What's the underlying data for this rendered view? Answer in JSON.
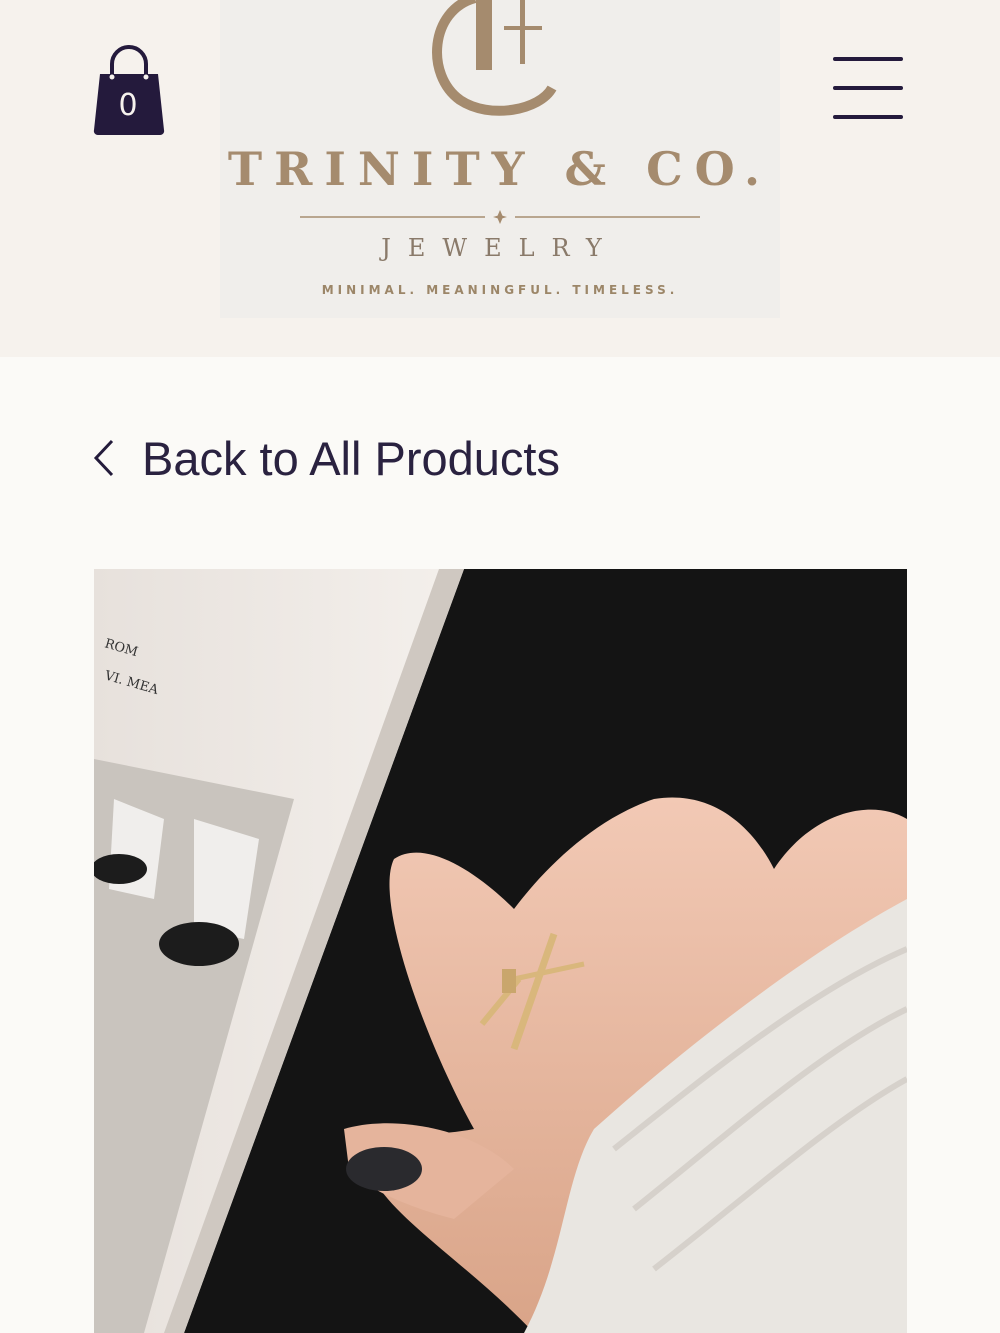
{
  "header": {
    "cart_count": "0",
    "brand": {
      "monogram": "C",
      "name": "TRINITY & CO.",
      "subtitle": "JEWELRY",
      "tagline": "MINIMAL. MEANINGFUL. TIMELESS."
    }
  },
  "nav": {
    "back_label": "Back to All Products"
  },
  "product": {
    "image_text": [
      "ROM",
      "VI. MEA"
    ]
  },
  "colors": {
    "header_bg": "#f6f2ed",
    "page_bg": "#fbfaf7",
    "navy": "#241a3c",
    "gold": "#a58b6e"
  }
}
